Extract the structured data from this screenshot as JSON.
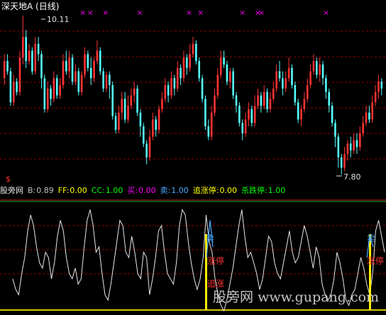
{
  "title": "深天地A (日线)",
  "indicator": {
    "name": "股旁网",
    "fields": [
      {
        "key": "B",
        "label": "B:",
        "value": "0.89",
        "label_color": "#c0c0c0",
        "value_color": "#c0c0c0"
      },
      {
        "key": "FF",
        "label": "FF:",
        "value": "0.00",
        "label_color": "#ffff00",
        "value_color": "#ffff00"
      },
      {
        "key": "CC",
        "label": "CC:",
        "value": "1.00",
        "label_color": "#00ff00",
        "value_color": "#00ff00"
      },
      {
        "key": "buy",
        "label": "买:",
        "value": "0.00",
        "label_color": "#ff00ff",
        "value_color": "#ff00ff"
      },
      {
        "key": "sell",
        "label": "卖:",
        "value": "1.00",
        "label_color": "#4aa8ff",
        "value_color": "#4aa8ff"
      },
      {
        "key": "chase",
        "label": "追涨停:",
        "value": "0.00",
        "label_color": "#ffff00",
        "value_color": "#ffff00"
      },
      {
        "key": "kill",
        "label": "杀跌停:",
        "value": "1.00",
        "label_color": "#00ff00",
        "value_color": "#00ff00"
      }
    ]
  },
  "annotations": {
    "high_price": "10.11",
    "low_price": "7.80",
    "dollar_mark": "$",
    "sell_signal": "卖",
    "limit_up": "涨停",
    "chase_up": "追涨"
  },
  "watermark": {
    "cn": "股旁网",
    "url": "www.gupang.com"
  },
  "colors": {
    "up": "#ff3333",
    "down": "#55ffff",
    "grid": "#8b0000",
    "marker": "#ff00ff",
    "osc_line": "#e6e6e6",
    "signal_line": "#4aa8ff",
    "frame": "#b22222"
  },
  "chart_data": [
    {
      "type": "candlestick",
      "title": "深天地A (日线)",
      "price_high": 10.11,
      "price_low": 7.8,
      "candles": [
        [
          9.2,
          9.45,
          9.55,
          9.1
        ],
        [
          9.45,
          9.3,
          9.55,
          9.25
        ],
        [
          9.3,
          8.85,
          9.35,
          8.8
        ],
        [
          8.85,
          9.15,
          9.25,
          8.8
        ],
        [
          9.15,
          9.0,
          9.2,
          8.95
        ],
        [
          9.0,
          9.5,
          9.6,
          8.95
        ],
        [
          9.5,
          9.8,
          10.11,
          9.4
        ],
        [
          9.8,
          9.45,
          9.9,
          9.35
        ],
        [
          9.45,
          9.6,
          9.7,
          9.4
        ],
        [
          9.6,
          9.3,
          9.65,
          9.25
        ],
        [
          9.3,
          9.7,
          9.8,
          9.25
        ],
        [
          9.7,
          9.55,
          9.8,
          9.45
        ],
        [
          9.55,
          9.2,
          9.6,
          9.05
        ],
        [
          9.2,
          8.75,
          9.25,
          8.7
        ],
        [
          8.75,
          9.05,
          9.15,
          8.7
        ],
        [
          9.05,
          8.9,
          9.1,
          8.8
        ],
        [
          8.9,
          9.2,
          9.3,
          8.85
        ],
        [
          9.2,
          8.95,
          9.25,
          8.9
        ],
        [
          8.95,
          9.1,
          9.2,
          8.9
        ],
        [
          9.1,
          9.45,
          9.55,
          9.05
        ],
        [
          9.45,
          9.3,
          9.6,
          9.25
        ],
        [
          9.3,
          9.5,
          9.6,
          9.2
        ],
        [
          9.5,
          9.15,
          9.55,
          9.1
        ],
        [
          9.15,
          9.3,
          9.4,
          9.1
        ],
        [
          9.3,
          9.0,
          9.35,
          8.95
        ],
        [
          9.0,
          9.25,
          9.3,
          8.95
        ],
        [
          9.25,
          9.55,
          9.65,
          9.2
        ],
        [
          9.55,
          9.35,
          9.6,
          9.3
        ],
        [
          9.35,
          9.2,
          9.5,
          9.1
        ],
        [
          9.2,
          9.45,
          9.5,
          9.15
        ],
        [
          9.45,
          9.6,
          9.75,
          9.4
        ],
        [
          9.6,
          9.3,
          9.65,
          9.25
        ],
        [
          9.3,
          9.05,
          9.35,
          9.0
        ],
        [
          9.05,
          9.25,
          9.3,
          9.0
        ],
        [
          9.25,
          9.1,
          9.3,
          8.9
        ],
        [
          9.1,
          8.65,
          9.15,
          8.6
        ],
        [
          8.65,
          8.45,
          8.7,
          8.4
        ],
        [
          8.45,
          8.7,
          8.8,
          8.4
        ],
        [
          8.7,
          8.9,
          9.0,
          8.6
        ],
        [
          8.9,
          8.6,
          9.0,
          8.55
        ],
        [
          8.6,
          8.8,
          8.95,
          8.55
        ],
        [
          8.8,
          8.95,
          9.05,
          8.75
        ],
        [
          8.95,
          9.05,
          9.15,
          8.85
        ],
        [
          9.05,
          8.7,
          9.1,
          8.65
        ],
        [
          8.7,
          8.5,
          8.75,
          8.35
        ],
        [
          8.5,
          8.25,
          8.55,
          8.2
        ],
        [
          8.25,
          8.05,
          8.3,
          7.95
        ],
        [
          8.05,
          8.35,
          8.45,
          8.0
        ],
        [
          8.35,
          8.6,
          8.7,
          8.3
        ],
        [
          8.6,
          8.45,
          8.65,
          8.35
        ],
        [
          8.45,
          8.75,
          8.8,
          8.4
        ],
        [
          8.75,
          8.9,
          9.0,
          8.7
        ],
        [
          8.9,
          9.1,
          9.2,
          8.85
        ],
        [
          9.1,
          8.95,
          9.15,
          8.85
        ],
        [
          8.95,
          9.2,
          9.3,
          8.9
        ],
        [
          9.2,
          9.05,
          9.25,
          8.95
        ],
        [
          9.05,
          9.35,
          9.45,
          9.0
        ],
        [
          9.35,
          9.2,
          9.4,
          9.1
        ],
        [
          9.2,
          9.5,
          9.6,
          9.15
        ],
        [
          9.5,
          9.35,
          9.55,
          9.25
        ],
        [
          9.35,
          9.55,
          9.7,
          9.3
        ],
        [
          9.55,
          9.7,
          9.8,
          9.5
        ],
        [
          9.7,
          9.45,
          9.75,
          9.4
        ],
        [
          9.45,
          9.2,
          9.5,
          9.15
        ],
        [
          9.2,
          8.9,
          9.25,
          8.85
        ],
        [
          8.9,
          8.5,
          8.95,
          8.45
        ],
        [
          8.5,
          8.35,
          8.6,
          8.3
        ],
        [
          8.35,
          8.7,
          8.8,
          8.3
        ],
        [
          8.7,
          8.95,
          9.05,
          8.65
        ],
        [
          8.95,
          9.25,
          9.35,
          8.9
        ],
        [
          9.25,
          9.5,
          9.6,
          9.2
        ],
        [
          9.5,
          9.4,
          9.6,
          9.35
        ],
        [
          9.4,
          9.15,
          9.45,
          9.1
        ],
        [
          9.15,
          9.3,
          9.35,
          9.05
        ],
        [
          9.3,
          8.95,
          9.35,
          8.9
        ],
        [
          8.95,
          8.8,
          9.0,
          8.7
        ],
        [
          8.8,
          8.55,
          8.85,
          8.5
        ],
        [
          8.55,
          8.4,
          8.6,
          8.3
        ],
        [
          8.4,
          8.6,
          8.7,
          8.35
        ],
        [
          8.6,
          8.75,
          8.85,
          8.5
        ],
        [
          8.75,
          8.55,
          8.8,
          8.5
        ],
        [
          8.55,
          8.8,
          8.95,
          8.5
        ],
        [
          8.8,
          8.95,
          9.05,
          8.75
        ],
        [
          8.95,
          8.8,
          9.0,
          8.7
        ],
        [
          8.8,
          9.0,
          9.1,
          8.75
        ],
        [
          9.0,
          8.75,
          9.05,
          8.7
        ],
        [
          8.75,
          8.9,
          9.0,
          8.7
        ],
        [
          8.9,
          9.05,
          9.15,
          8.85
        ],
        [
          9.05,
          9.3,
          9.4,
          9.0
        ],
        [
          9.3,
          9.2,
          9.45,
          9.15
        ],
        [
          9.2,
          9.05,
          9.3,
          8.95
        ],
        [
          9.05,
          9.2,
          9.3,
          9.0
        ],
        [
          9.2,
          9.35,
          9.5,
          9.15
        ],
        [
          9.35,
          9.1,
          9.4,
          9.05
        ],
        [
          9.1,
          8.85,
          9.15,
          8.8
        ],
        [
          8.85,
          8.6,
          8.9,
          8.55
        ],
        [
          8.6,
          8.75,
          8.8,
          8.5
        ],
        [
          8.75,
          8.9,
          9.0,
          8.7
        ],
        [
          8.9,
          9.1,
          9.2,
          8.85
        ],
        [
          9.1,
          9.3,
          9.4,
          9.05
        ],
        [
          9.3,
          9.45,
          9.55,
          9.25
        ],
        [
          9.45,
          9.25,
          9.5,
          9.2
        ],
        [
          9.25,
          9.4,
          9.5,
          9.15
        ],
        [
          9.4,
          9.2,
          9.45,
          9.1
        ],
        [
          9.2,
          9.0,
          9.25,
          8.9
        ],
        [
          9.0,
          8.8,
          9.05,
          8.7
        ],
        [
          8.8,
          8.55,
          8.85,
          8.5
        ],
        [
          8.55,
          8.35,
          8.6,
          8.2
        ],
        [
          8.35,
          8.05,
          8.4,
          7.9
        ],
        [
          8.05,
          7.9,
          8.1,
          7.8
        ],
        [
          7.9,
          8.1,
          8.2,
          7.85
        ],
        [
          8.1,
          8.25,
          8.3,
          8.0
        ],
        [
          8.25,
          8.15,
          8.35,
          8.05
        ],
        [
          8.15,
          8.3,
          8.4,
          8.1
        ],
        [
          8.3,
          8.2,
          8.4,
          8.1
        ],
        [
          8.2,
          8.4,
          8.5,
          8.15
        ],
        [
          8.4,
          8.55,
          8.65,
          8.35
        ],
        [
          8.55,
          8.7,
          8.8,
          8.5
        ],
        [
          8.7,
          8.6,
          8.8,
          8.55
        ],
        [
          8.6,
          8.85,
          8.95,
          8.55
        ],
        [
          8.85,
          9.0,
          9.1,
          8.8
        ],
        [
          9.0,
          9.15,
          9.25,
          8.9
        ],
        [
          9.15,
          9.05,
          9.2,
          8.95
        ]
      ],
      "markers": [
        0.21,
        0.23,
        0.27,
        0.36,
        0.49,
        0.52,
        0.63,
        0.67,
        0.68,
        0.85
      ]
    },
    {
      "type": "line",
      "name": "股旁网",
      "ylim": [
        0,
        1
      ],
      "values": [
        0.3,
        0.2,
        0.15,
        0.35,
        0.5,
        0.75,
        0.9,
        0.8,
        0.6,
        0.45,
        0.4,
        0.55,
        0.5,
        0.3,
        0.45,
        0.7,
        0.85,
        0.75,
        0.5,
        0.35,
        0.3,
        0.4,
        0.25,
        0.3,
        0.6,
        0.85,
        0.95,
        0.8,
        0.55,
        0.6,
        0.35,
        0.15,
        0.1,
        0.25,
        0.45,
        0.65,
        0.85,
        0.8,
        0.55,
        0.5,
        0.7,
        0.55,
        0.35,
        0.3,
        0.55,
        0.5,
        0.15,
        0.3,
        0.5,
        0.75,
        0.8,
        0.55,
        0.35,
        0.3,
        0.25,
        0.45,
        0.8,
        0.95,
        0.9,
        0.65,
        0.45,
        0.3,
        0.2,
        0.3,
        0.5,
        0.9,
        0.65,
        0.55,
        0.3,
        0.15,
        0.05,
        0.0,
        0.1,
        0.25,
        0.4,
        0.6,
        0.8,
        0.95,
        0.7,
        0.5,
        0.55,
        0.45,
        0.35,
        0.2,
        0.3,
        0.5,
        0.7,
        0.65,
        0.45,
        0.35,
        0.3,
        0.45,
        0.6,
        0.75,
        0.55,
        0.45,
        0.5,
        0.65,
        0.8,
        0.7,
        0.55,
        0.4,
        0.6,
        0.5,
        0.25,
        0.15,
        0.1,
        0.15,
        0.3,
        0.55,
        0.45,
        0.3,
        0.1,
        0.05,
        0.15,
        0.2,
        0.35,
        0.5,
        0.4,
        0.25,
        0.15,
        0.35,
        0.75,
        0.85,
        0.7,
        0.55
      ],
      "signal": [
        0.85,
        0.9,
        1.0,
        0.7,
        0.85,
        0.95,
        0.55,
        0.8,
        0.95,
        0.6
      ]
    }
  ]
}
